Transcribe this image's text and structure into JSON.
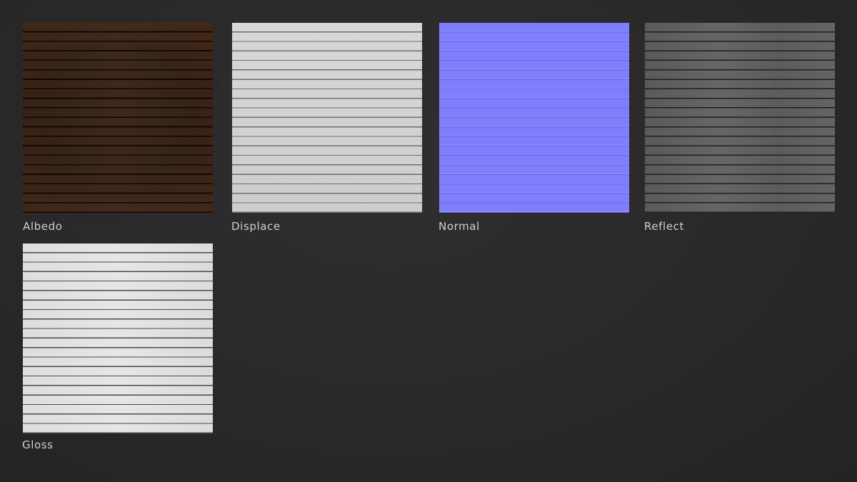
{
  "maps": [
    {
      "label": "Albedo",
      "color": "#3a2418"
    },
    {
      "label": "Displace",
      "color": "#d3d3d3"
    },
    {
      "label": "Normal",
      "color": "#7f7ffc"
    },
    {
      "label": "Reflect",
      "color": "#606060"
    },
    {
      "label": "Gloss",
      "color": "#e2e2e2"
    }
  ]
}
